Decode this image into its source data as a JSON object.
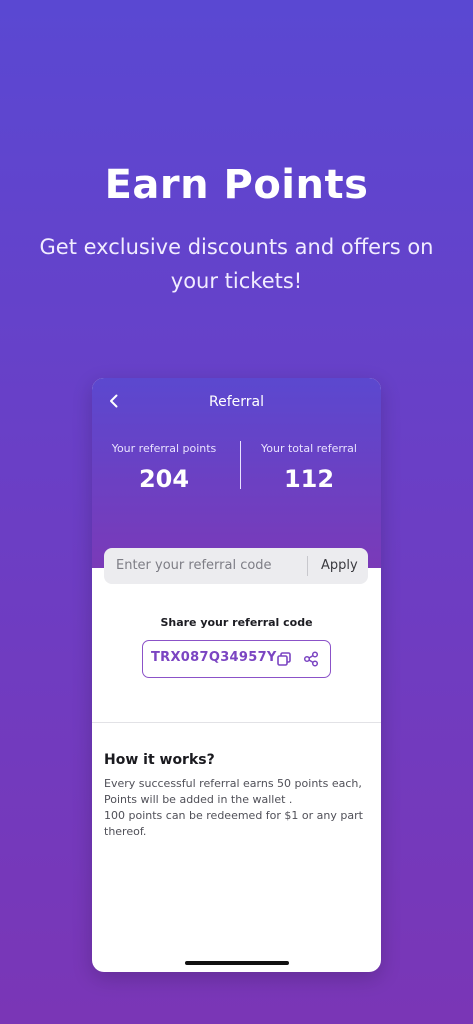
{
  "hero": {
    "title": "Earn Points",
    "subtitle": "Get exclusive discounts and offers on your tickets!"
  },
  "screen": {
    "title": "Referral",
    "stats": {
      "points_label": "Your referral points",
      "points_value": "204",
      "total_label": "Your total referral",
      "total_value": "112"
    },
    "code_input": {
      "placeholder": "Enter your referral code",
      "apply_label": "Apply"
    },
    "share": {
      "label": "Share your referral code",
      "code": "TRX087Q34957Y"
    },
    "how": {
      "title": "How it works?",
      "lines": [
        "Every successful referral earns 50 points each,",
        "Points will be added in the wallet .",
        "100 points can be redeemed for $1 or any part thereof."
      ]
    }
  },
  "colors": {
    "accent": "#7b45c2",
    "background_top": "#5a48d2",
    "background_bottom": "#7a36b6"
  },
  "icons": {
    "back": "chevron-left-icon",
    "copy": "copy-icon",
    "share": "share-icon"
  }
}
